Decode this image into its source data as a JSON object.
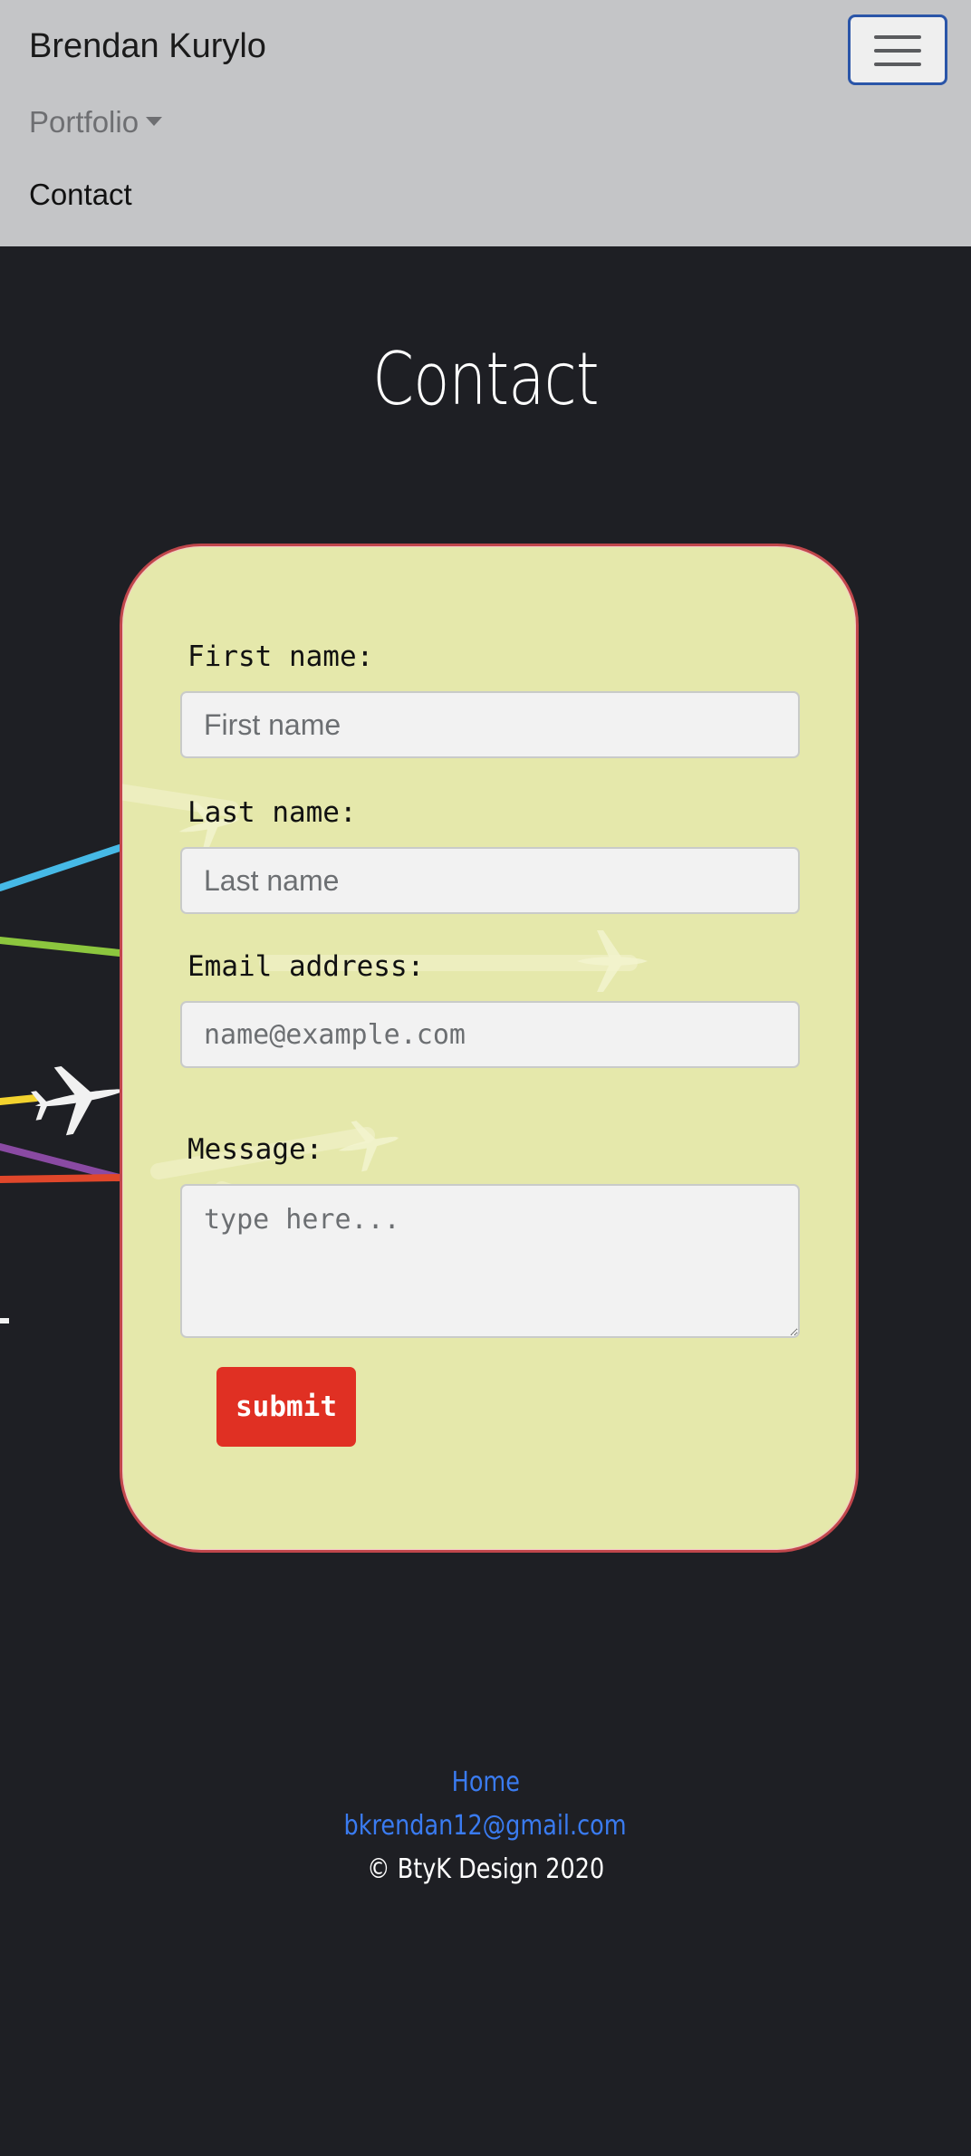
{
  "navbar": {
    "brand": "Brendan Kurylo",
    "items": [
      {
        "label": "Portfolio"
      },
      {
        "label": "Contact"
      }
    ]
  },
  "page": {
    "title": "Contact"
  },
  "form": {
    "first_name": {
      "label": "First name:",
      "placeholder": "First name",
      "value": ""
    },
    "last_name": {
      "label": "Last name:",
      "placeholder": "Last name",
      "value": ""
    },
    "email": {
      "label": "Email address:",
      "placeholder": "name@example.com",
      "value": ""
    },
    "message": {
      "label": "Message:",
      "placeholder": "type here...",
      "value": ""
    },
    "submit_label": "submit"
  },
  "footer": {
    "home_link": "Home",
    "email_link": "bkrendan12@gmail.com",
    "copyright": "© BtyK Design 2020"
  },
  "colors": {
    "navbar_bg": "#c4c5c7",
    "page_bg": "#1e1f24",
    "card_bg": "#e5e8ab",
    "card_border": "#c0464b",
    "submit_bg": "#e03023",
    "link": "#3a7bf0"
  }
}
